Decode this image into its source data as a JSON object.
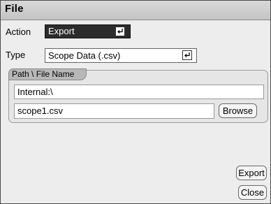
{
  "window": {
    "title": "File"
  },
  "action": {
    "label": "Action",
    "value": "Export"
  },
  "type": {
    "label": "Type",
    "value": "Scope Data (.csv)"
  },
  "path_group": {
    "title": "Path \\ File Name",
    "path": "Internal:\\",
    "file_name": "scope1.csv",
    "browse_label": "Browse"
  },
  "buttons": {
    "export_label": "Export",
    "close_label": "Close"
  },
  "icons": {
    "enter": "enter-return-icon"
  }
}
